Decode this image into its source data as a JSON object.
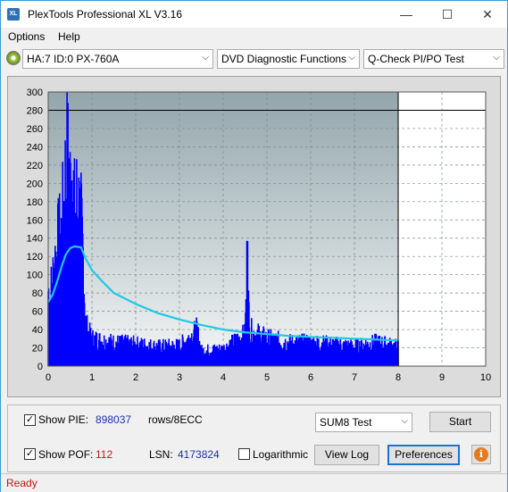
{
  "window": {
    "title": "PlexTools Professional XL V3.16",
    "logo_text": "XL",
    "minimize_glyph": "—",
    "maximize_glyph": "☐",
    "close_glyph": "✕"
  },
  "menu": {
    "options": "Options",
    "help": "Help"
  },
  "toolbar": {
    "drive": "HA:7 ID:0  PX-760A",
    "function": "DVD Diagnostic Functions",
    "test": "Q-Check PI/PO Test",
    "dropdown_glyph": "⌵"
  },
  "chart_data": {
    "type": "bar",
    "x_ticks": [
      "0",
      "1",
      "2",
      "3",
      "4",
      "5",
      "6",
      "7",
      "8",
      "9",
      "10"
    ],
    "y_ticks": [
      "0",
      "20",
      "40",
      "60",
      "80",
      "100",
      "120",
      "140",
      "160",
      "180",
      "200",
      "220",
      "240",
      "260",
      "280",
      "300"
    ],
    "xlim": [
      0,
      10
    ],
    "ylim": [
      0,
      300
    ],
    "horizontal_line_y": 280,
    "vertical_line_x": 8,
    "grid": true,
    "colors": {
      "pie_bars": "#0000ff",
      "speed_curve": "#1ec8e6",
      "plot_bg_top": "#93a6ac",
      "plot_bg_bottom": "#f4f6f6",
      "unused_area": "#ffffff"
    },
    "pie_profile": [
      [
        0,
        100
      ],
      [
        0.05,
        90
      ],
      [
        0.1,
        110
      ],
      [
        0.15,
        135
      ],
      [
        0.2,
        150
      ],
      [
        0.25,
        160
      ],
      [
        0.3,
        170
      ],
      [
        0.35,
        200
      ],
      [
        0.4,
        250
      ],
      [
        0.45,
        285
      ],
      [
        0.5,
        230
      ],
      [
        0.55,
        265
      ],
      [
        0.6,
        195
      ],
      [
        0.65,
        210
      ],
      [
        0.7,
        205
      ],
      [
        0.75,
        180
      ],
      [
        0.8,
        150
      ],
      [
        0.85,
        60
      ],
      [
        0.9,
        45
      ],
      [
        0.95,
        40
      ],
      [
        1.0,
        35
      ],
      [
        1.5,
        30
      ],
      [
        2.0,
        28
      ],
      [
        2.5,
        25
      ],
      [
        3.0,
        26
      ],
      [
        3.4,
        45
      ],
      [
        3.5,
        20
      ],
      [
        4.0,
        22
      ],
      [
        4.5,
        40
      ],
      [
        4.55,
        137
      ],
      [
        4.6,
        45
      ],
      [
        5.0,
        35
      ],
      [
        5.5,
        30
      ],
      [
        6.0,
        30
      ],
      [
        6.5,
        28
      ],
      [
        7.0,
        25
      ],
      [
        7.5,
        30
      ],
      [
        8.0,
        25
      ]
    ],
    "speed_curve": [
      [
        0,
        70
      ],
      [
        0.1,
        78
      ],
      [
        0.2,
        92
      ],
      [
        0.3,
        108
      ],
      [
        0.4,
        122
      ],
      [
        0.5,
        129
      ],
      [
        0.6,
        131
      ],
      [
        0.75,
        130
      ],
      [
        0.85,
        118
      ],
      [
        1.0,
        105
      ],
      [
        1.25,
        92
      ],
      [
        1.5,
        80
      ],
      [
        2.0,
        68
      ],
      [
        2.5,
        58
      ],
      [
        3.0,
        51
      ],
      [
        3.5,
        45
      ],
      [
        4.0,
        40
      ],
      [
        4.5,
        37
      ],
      [
        5.0,
        35
      ],
      [
        5.5,
        33
      ],
      [
        6.0,
        32
      ],
      [
        6.5,
        31
      ],
      [
        7.0,
        30
      ],
      [
        7.5,
        29
      ],
      [
        8.0,
        28
      ]
    ]
  },
  "controls": {
    "show_pie_label": "Show PIE:",
    "pie_value": "898037",
    "pie_unit": "rows/8ECC",
    "show_pof_label": "Show POF:",
    "pof_value": "112",
    "lsn_label": "LSN:",
    "lsn_value": "4173824",
    "logarithmic_label": "Logarithmic",
    "test_mode": "SUM8 Test",
    "start_button": "Start",
    "view_log_button": "View Log",
    "preferences_button": "Preferences",
    "info_glyph": "i",
    "check_glyph": "✓"
  },
  "status": {
    "text": "Ready"
  }
}
